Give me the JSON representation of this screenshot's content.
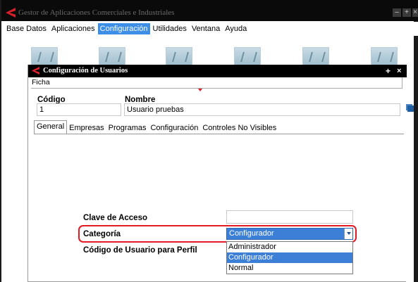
{
  "app": {
    "title": "Gestor de Aplicaciones Comerciales e Industriales",
    "window_buttons": [
      "–",
      "+",
      "×"
    ]
  },
  "menubar": {
    "items": [
      "Base Datos",
      "Aplicaciones",
      "Configuración",
      "Utilidades",
      "Ventana",
      "Ayuda"
    ],
    "active": "Configuración"
  },
  "dialog": {
    "title": "Configuración de Usuarios",
    "buttons": {
      "maximize": "+",
      "close": "×"
    },
    "section_tab": "Ficha",
    "codigo": {
      "label": "Código",
      "value": "1"
    },
    "nombre": {
      "label": "Nombre",
      "value": "Usuario pruebas"
    },
    "tabs": [
      "General",
      "Empresas",
      "Programas",
      "Configuración",
      "Controles No Visibles"
    ],
    "active_tab": "General",
    "clave_acceso": {
      "label": "Clave de Acceso",
      "value": ""
    },
    "categoria": {
      "label": "Categoría",
      "selected": "Configurador",
      "options": [
        "Administrador",
        "Configurador",
        "Normal"
      ]
    },
    "codigo_perfil": {
      "label": "Código de Usuario para Perfil"
    }
  },
  "colors": {
    "accent": "#3d8ee6",
    "highlight_ring": "#e31b23",
    "titlebar": "#000000"
  }
}
